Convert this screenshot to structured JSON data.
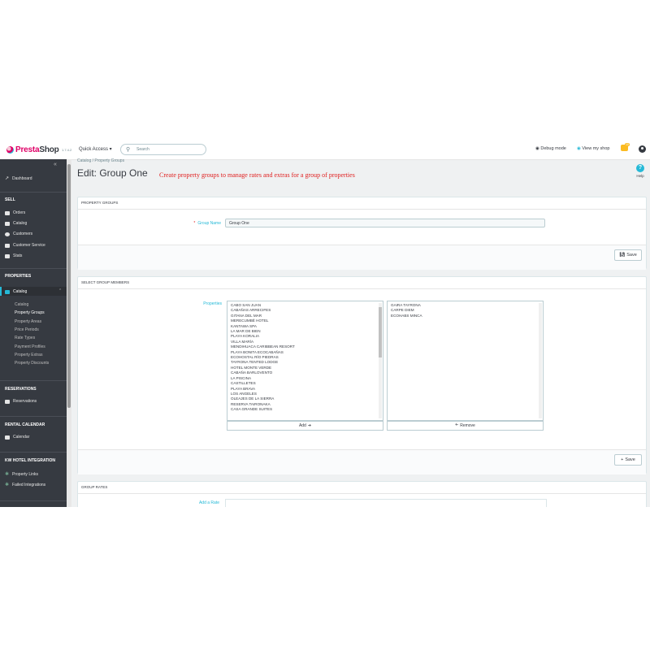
{
  "header": {
    "logo_brand": "Presta",
    "logo_brand2": "Shop",
    "version": "1.7.4.2",
    "quick_access": "Quick Access ▾",
    "search_placeholder": "Search",
    "debug_mode": "Debug mode",
    "view_shop": "View my shop",
    "notif_count": "10"
  },
  "sidebar": {
    "dashboard": "Dashboard",
    "sell": "SELL",
    "orders": "Orders",
    "catalog": "Catalog",
    "customers": "Customers",
    "customer_service": "Customer Service",
    "stats": "Stats",
    "properties": "PROPERTIES",
    "prop_catalog": "Catalog",
    "sub": [
      "Catalog",
      "Property Groups",
      "Property Areas",
      "Price Periods",
      "Rate Types",
      "Payment Profiles",
      "Property Extras",
      "Property Discounts"
    ],
    "reservations_section": "RESERVATIONS",
    "reservations": "Reservations",
    "rental_calendar": "RENTAL CALENDAR",
    "calendar": "Calendar",
    "kw_hotel": "KW HOTEL INTEGRATION",
    "property_links": "Property Links",
    "failed_integrations": "Failed Integrations"
  },
  "page": {
    "breadcrumb": "Catalog  /  Property Groups",
    "title": "Edit: Group One",
    "note": "Create property groups to manage rates and extras for a group of properties",
    "help": "Help"
  },
  "property_groups": {
    "heading": "PROPERTY GROUPS",
    "group_name_label": "Group Name",
    "group_name_value": "Group One",
    "save": "Save"
  },
  "members": {
    "heading": "SELECT GROUP MEMBERS",
    "properties_label": "Properties",
    "available": [
      "CABO SAN JUAN",
      "CABAÑAS ARRECIFES",
      "GITANA DEL MAR",
      "MERECUMBÉ HOTEL",
      "KANTAWA SPA",
      "LA MAR DE BIEN",
      "PLAYA KORALIA",
      "VILLA MARÍA",
      "MENDIHUACA CARIBBEAN RESORT",
      "PLAYA BONITA ECOCABAÑAS",
      "ECOHOSTAL RÍO PIEDRAS",
      "TAYRONA TENTED LODGE",
      "HOTEL MONTE VERDE",
      "CABAÑA BARLOVENTO",
      "LA PISCINA",
      "CASTILLETES",
      "PLAYA BRAVA",
      "LOS ANGELES",
      "OLEAJES DE LA SIERRA",
      "RESERVA TAIRONAKA",
      "CASA GRANDE SUITES"
    ],
    "selected": [
      "GAIRA TAYRONA",
      "CARPE DIEM",
      "ECOHABS MINCA"
    ],
    "add": "Add",
    "remove": "Remove",
    "save": "Save"
  },
  "rates": {
    "heading": "GROUP RATES",
    "add_rate": "Add a Rate"
  }
}
